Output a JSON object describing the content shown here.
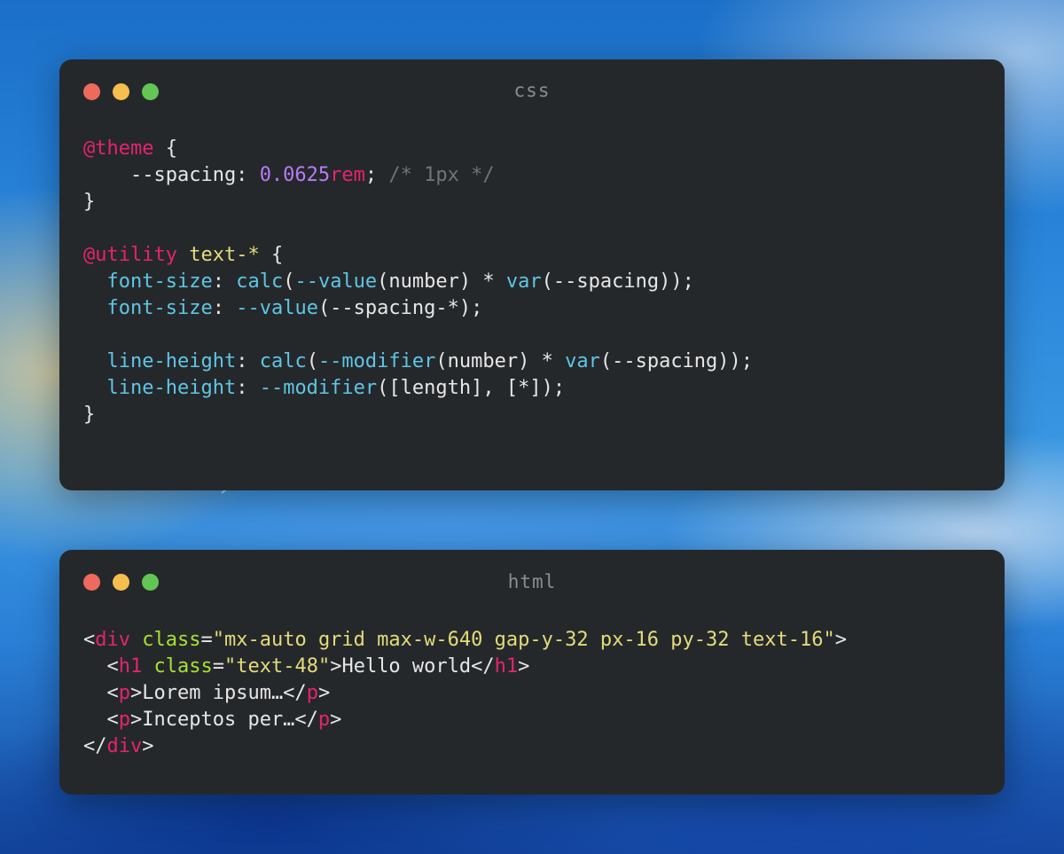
{
  "colors": {
    "editor_background": "#25282b",
    "title_text": "#8a8d91",
    "traffic_close": "#ee6a5f",
    "traffic_minimize": "#f5be4f",
    "traffic_zoom": "#62c554",
    "plain": "#e6e6e6",
    "atrule": "#e6226f",
    "number": "#b67cf5",
    "comment": "#6f7479",
    "selector": "#e3dc7a",
    "property": "#5ec6e4",
    "tag": "#e6226f",
    "attr": "#a6e22e",
    "string": "#e3dc7a"
  },
  "windows": [
    {
      "id": "css",
      "title": "css",
      "lines": [
        [
          {
            "t": "@theme",
            "k": "atrule"
          },
          {
            "t": " {",
            "k": "plain"
          }
        ],
        [
          {
            "t": "    --spacing: ",
            "k": "plain"
          },
          {
            "t": "0.0625",
            "k": "number"
          },
          {
            "t": "rem",
            "k": "atrule"
          },
          {
            "t": "; ",
            "k": "plain"
          },
          {
            "t": "/* 1px */",
            "k": "comment"
          }
        ],
        [
          {
            "t": "}",
            "k": "plain"
          }
        ],
        [],
        [
          {
            "t": "@utility",
            "k": "atrule"
          },
          {
            "t": " ",
            "k": "plain"
          },
          {
            "t": "text-*",
            "k": "selector"
          },
          {
            "t": " {",
            "k": "plain"
          }
        ],
        [
          {
            "t": "  ",
            "k": "plain"
          },
          {
            "t": "font-size",
            "k": "property"
          },
          {
            "t": ": ",
            "k": "plain"
          },
          {
            "t": "calc",
            "k": "property"
          },
          {
            "t": "(",
            "k": "plain"
          },
          {
            "t": "--value",
            "k": "property"
          },
          {
            "t": "(number) * ",
            "k": "plain"
          },
          {
            "t": "var",
            "k": "property"
          },
          {
            "t": "(--spacing));",
            "k": "plain"
          }
        ],
        [
          {
            "t": "  ",
            "k": "plain"
          },
          {
            "t": "font-size",
            "k": "property"
          },
          {
            "t": ": ",
            "k": "plain"
          },
          {
            "t": "--value",
            "k": "property"
          },
          {
            "t": "(--spacing-*);",
            "k": "plain"
          }
        ],
        [],
        [
          {
            "t": "  ",
            "k": "plain"
          },
          {
            "t": "line-height",
            "k": "property"
          },
          {
            "t": ": ",
            "k": "plain"
          },
          {
            "t": "calc",
            "k": "property"
          },
          {
            "t": "(",
            "k": "plain"
          },
          {
            "t": "--modifier",
            "k": "property"
          },
          {
            "t": "(number) * ",
            "k": "plain"
          },
          {
            "t": "var",
            "k": "property"
          },
          {
            "t": "(--spacing));",
            "k": "plain"
          }
        ],
        [
          {
            "t": "  ",
            "k": "plain"
          },
          {
            "t": "line-height",
            "k": "property"
          },
          {
            "t": ": ",
            "k": "plain"
          },
          {
            "t": "--modifier",
            "k": "property"
          },
          {
            "t": "([length], [*]);",
            "k": "plain"
          }
        ],
        [
          {
            "t": "}",
            "k": "plain"
          }
        ]
      ]
    },
    {
      "id": "html",
      "title": "html",
      "lines": [
        [
          {
            "t": "<",
            "k": "plain"
          },
          {
            "t": "div",
            "k": "tag"
          },
          {
            "t": " ",
            "k": "plain"
          },
          {
            "t": "class",
            "k": "attr"
          },
          {
            "t": "=",
            "k": "plain"
          },
          {
            "t": "\"mx-auto grid max-w-640 gap-y-32 px-16 py-32 text-16\"",
            "k": "string"
          },
          {
            "t": ">",
            "k": "plain"
          }
        ],
        [
          {
            "t": "  <",
            "k": "plain"
          },
          {
            "t": "h1",
            "k": "tag"
          },
          {
            "t": " ",
            "k": "plain"
          },
          {
            "t": "class",
            "k": "attr"
          },
          {
            "t": "=",
            "k": "plain"
          },
          {
            "t": "\"text-48\"",
            "k": "string"
          },
          {
            "t": ">Hello world</",
            "k": "plain"
          },
          {
            "t": "h1",
            "k": "tag"
          },
          {
            "t": ">",
            "k": "plain"
          }
        ],
        [
          {
            "t": "  <",
            "k": "plain"
          },
          {
            "t": "p",
            "k": "tag"
          },
          {
            "t": ">Lorem ipsum…</",
            "k": "plain"
          },
          {
            "t": "p",
            "k": "tag"
          },
          {
            "t": ">",
            "k": "plain"
          }
        ],
        [
          {
            "t": "  <",
            "k": "plain"
          },
          {
            "t": "p",
            "k": "tag"
          },
          {
            "t": ">Inceptos per…</",
            "k": "plain"
          },
          {
            "t": "p",
            "k": "tag"
          },
          {
            "t": ">",
            "k": "plain"
          }
        ],
        [
          {
            "t": "</",
            "k": "plain"
          },
          {
            "t": "div",
            "k": "tag"
          },
          {
            "t": ">",
            "k": "plain"
          }
        ]
      ]
    }
  ]
}
